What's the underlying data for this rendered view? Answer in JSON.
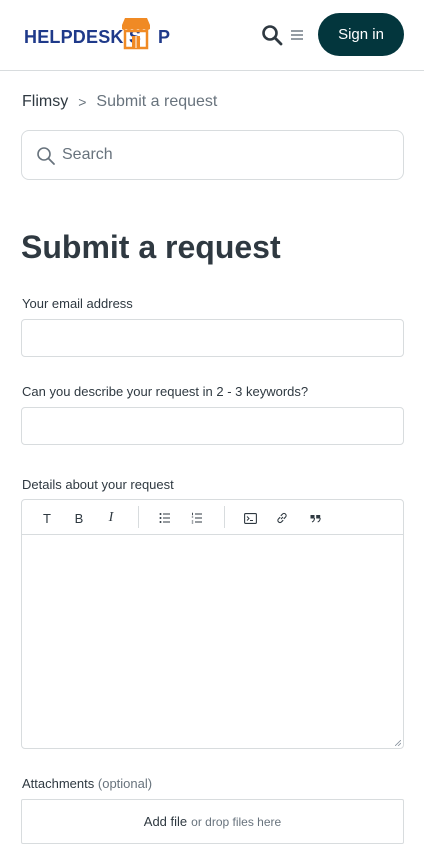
{
  "header": {
    "logo_text_left": "HELPDESK S",
    "logo_text_right": "P",
    "logo_colors": {
      "text": "#1f3a8a",
      "shop": "#f08a24"
    },
    "search_icon": "search-icon",
    "menu_icon": "hamburger-menu-icon",
    "signin_label": "Sign in",
    "signin_color": "#03363d"
  },
  "breadcrumb": {
    "items": [
      "Flimsy",
      "Submit a request"
    ],
    "separator": ">"
  },
  "search": {
    "placeholder": "Search",
    "value": ""
  },
  "page": {
    "title": "Submit a request"
  },
  "form": {
    "email_label": "Your email address",
    "email_value": "",
    "subject_label": "Can you describe your request in 2 - 3 keywords?",
    "subject_value": "",
    "details_label": "Details about your request",
    "toolbar": {
      "text_label": "T",
      "bold_label": "B",
      "italic_label": "I",
      "icons": [
        "bulleted-list-icon",
        "numbered-list-icon",
        "code-block-icon",
        "link-icon",
        "quote-icon"
      ]
    },
    "details_value": "",
    "attachments_label": "Attachments",
    "attachments_optional": "(optional)",
    "add_file_label": "Add file",
    "drop_hint": "or drop files here"
  }
}
